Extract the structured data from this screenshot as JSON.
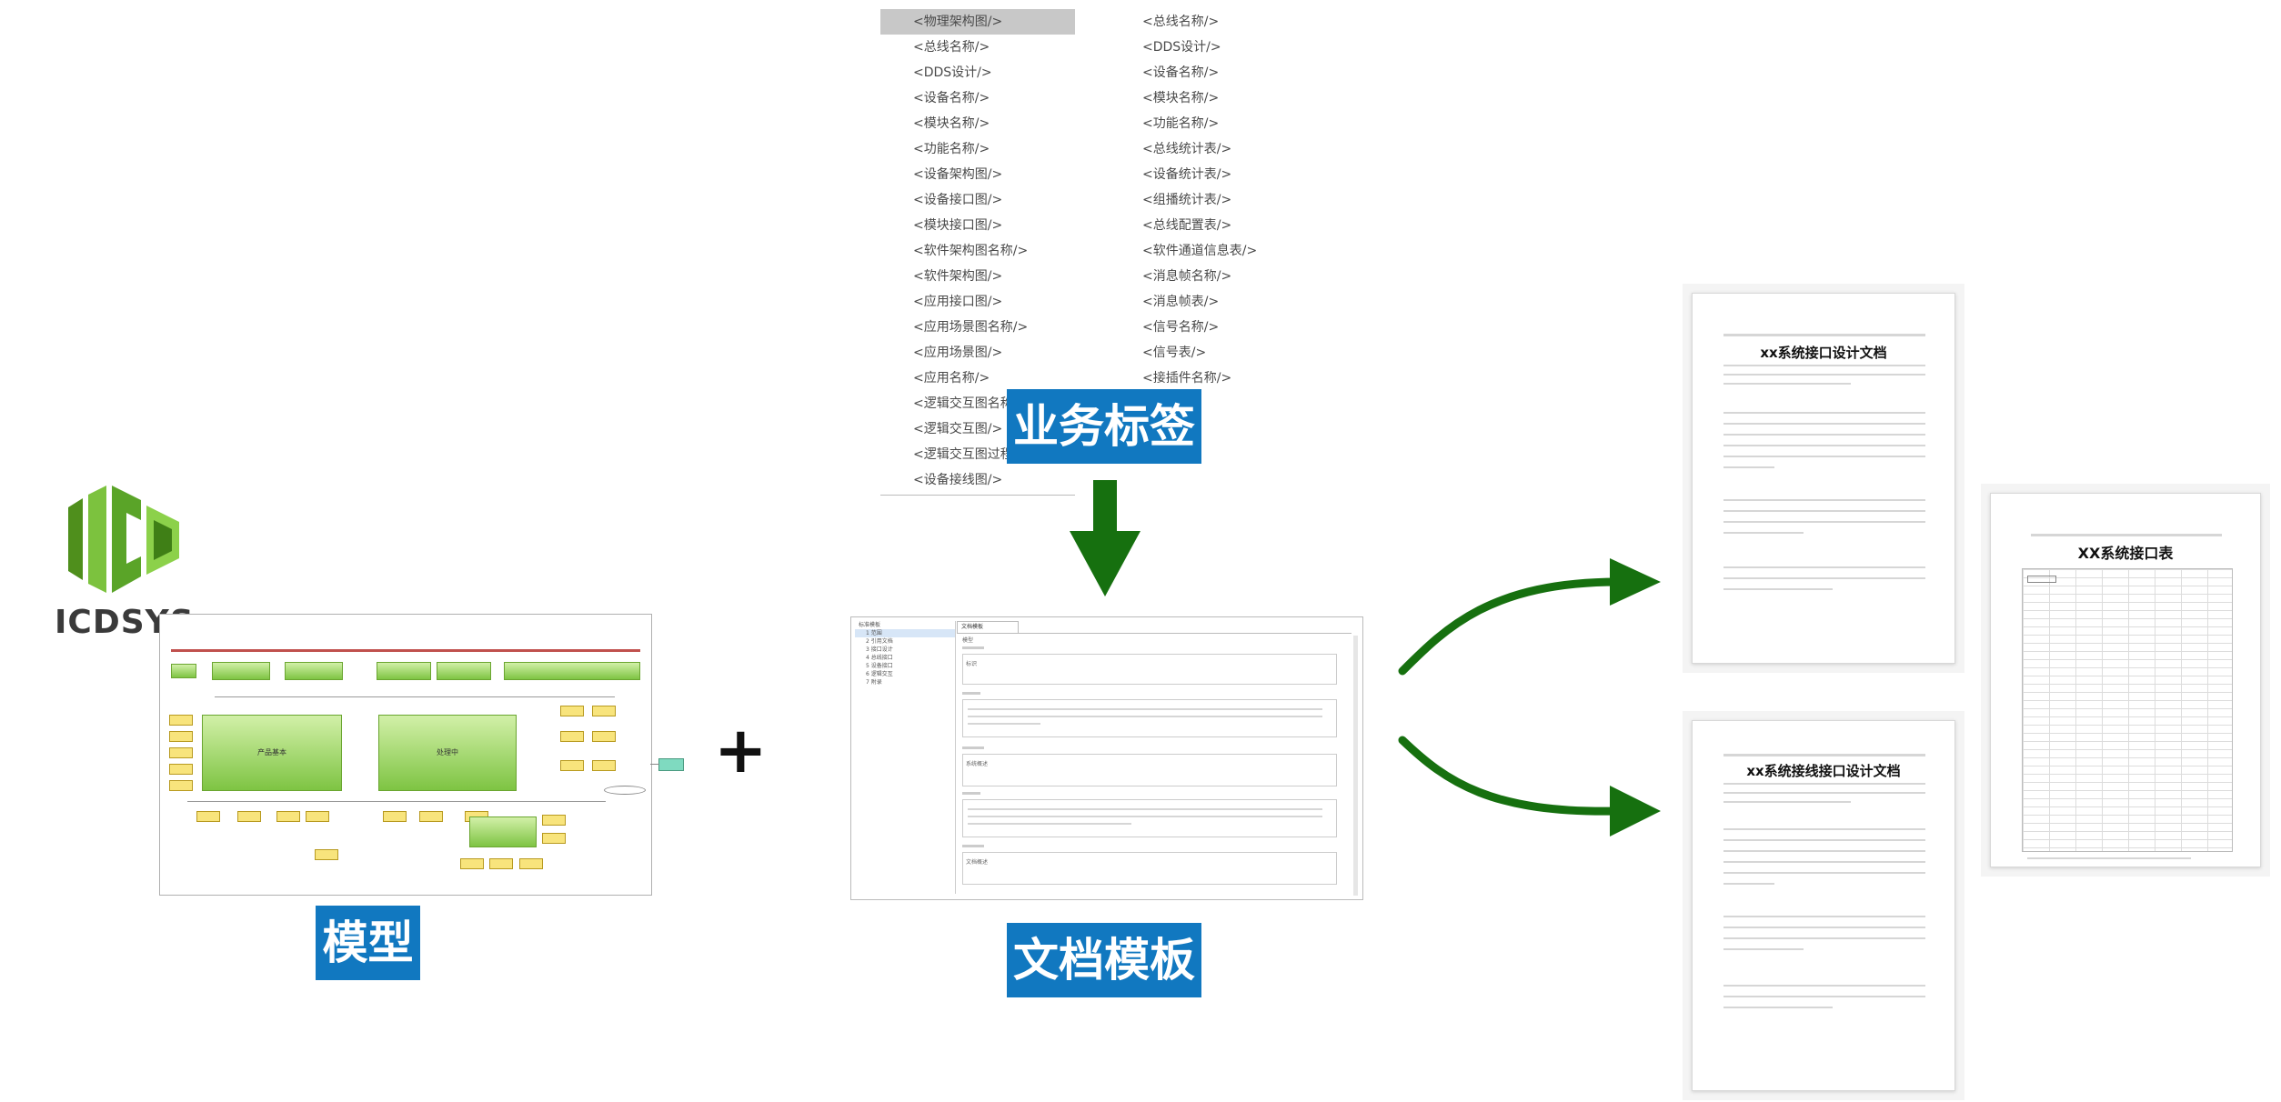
{
  "logo": {
    "text": "ICDSYS"
  },
  "labels": {
    "model": "模型",
    "business_tags": "业务标签",
    "doc_template": "文档模板"
  },
  "plus": "+",
  "tags_left": [
    "<物理架构图/>",
    "<总线名称/>",
    "<DDS设计/>",
    "<设备名称/>",
    "<模块名称/>",
    "<功能名称/>",
    "<设备架构图/>",
    "<设备接口图/>",
    "<模块接口图/>",
    "<软件架构图名称/>",
    "<软件架构图/>",
    "<应用接口图/>",
    "<应用场景图名称/>",
    "<应用场景图/>",
    "<应用名称/>",
    "<逻辑交互图名称/>",
    "<逻辑交互图/>",
    "<逻辑交互图过程/>",
    "<设备接线图/>"
  ],
  "tags_right": [
    "<总线名称/>",
    "<DDS设计/>",
    "<设备名称/>",
    "<模块名称/>",
    "<功能名称/>",
    "<总线统计表/>",
    "<设备统计表/>",
    "<组播统计表/>",
    "<总线配置表/>",
    "<软件通道信息表/>",
    "<消息帧名称/>",
    "<消息帧表/>",
    "<信号名称/>",
    "<信号表/>",
    "<接插件名称/>"
  ],
  "outputs": {
    "doc1_title": "xx系统接口设计文档",
    "doc2_title": "xx系统接线接口设计文档",
    "table_title": "XX系统接口表"
  },
  "model_diagram": {
    "center_left": "产品基本",
    "center_right": "处理中"
  },
  "template_preview": {
    "tree": [
      "标准模板",
      "1 范围",
      "2 引用文档",
      "3 接口设计",
      "4 总线接口",
      "5 设备接口",
      "6 逻辑交互",
      "7 附录"
    ],
    "tab": "文档模板",
    "sections": [
      "模型",
      "标识",
      "系统概述",
      "文档概述"
    ]
  },
  "colors": {
    "label_bg": "#1178c0",
    "arrow": "#16700f",
    "accent_green": "#7ec443"
  }
}
